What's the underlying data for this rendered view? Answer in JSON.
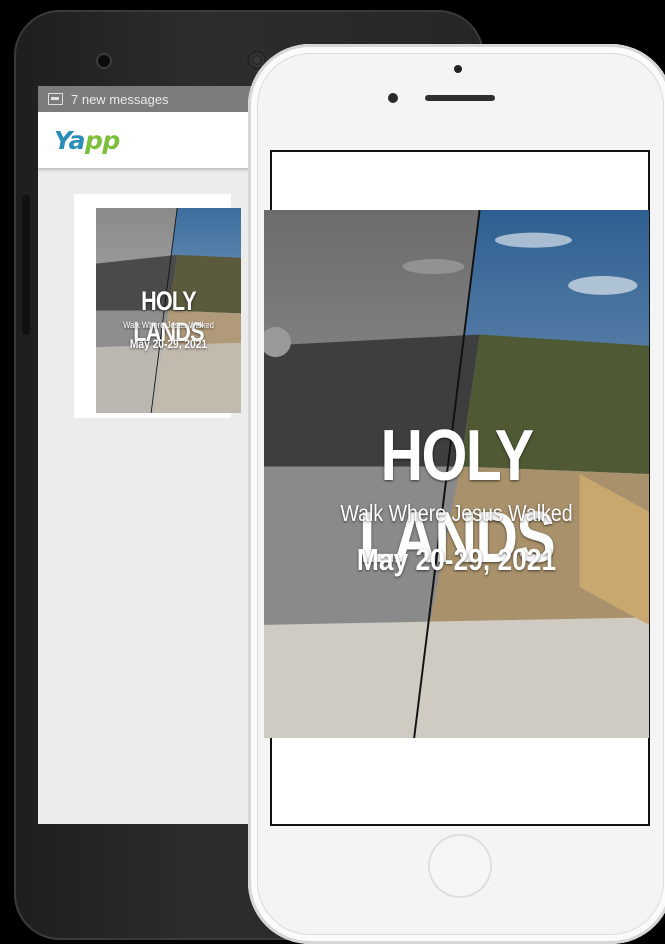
{
  "android": {
    "status_message": "7 new messages",
    "app_logo_part1": "Ya",
    "app_logo_part2": "pp"
  },
  "banner": {
    "title": "HOLY LANDS",
    "subtitle": "Walk Where Jesus Walked",
    "date": "May 20-29, 2021"
  },
  "colors": {
    "logo_blue": "#2a8fb8",
    "logo_green": "#7cbf3a",
    "android_body": "#262626",
    "iphone_body": "#f4f4f4"
  }
}
